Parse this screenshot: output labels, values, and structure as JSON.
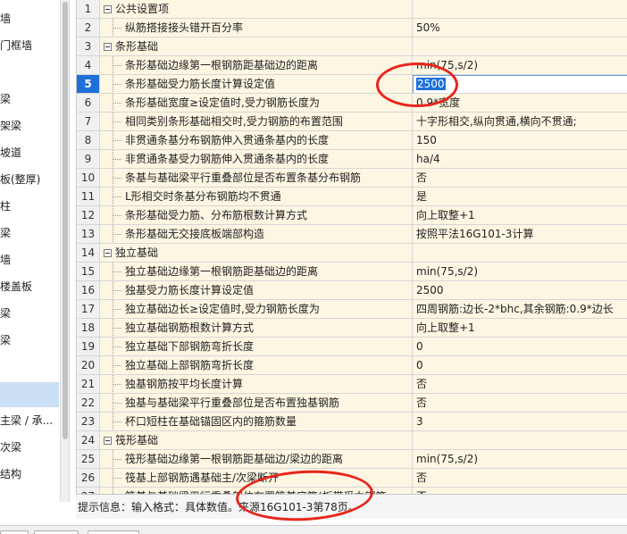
{
  "left_panel": {
    "items": [
      {
        "label": "墙"
      },
      {
        "label": "门框墙"
      },
      {
        "label": "梁"
      },
      {
        "label": "架梁"
      },
      {
        "label": "坡道"
      },
      {
        "label": "板(整厚)"
      },
      {
        "label": "柱"
      },
      {
        "label": "梁"
      },
      {
        "label": "墙"
      },
      {
        "label": "楼盖板"
      },
      {
        "label": "梁"
      },
      {
        "label": "梁"
      },
      {
        "label": ""
      },
      {
        "label": "主梁 / 承..."
      },
      {
        "label": "次梁"
      },
      {
        "label": "结构"
      }
    ]
  },
  "grid": {
    "rows": [
      {
        "num": "1",
        "name": "公共设置项",
        "value": "",
        "group": true
      },
      {
        "num": "2",
        "name": "纵筋搭接接头错开百分率",
        "value": "50%"
      },
      {
        "num": "3",
        "name": "条形基础",
        "value": "",
        "group": true
      },
      {
        "num": "4",
        "name": "条形基础边缘第一根钢筋距基础边的距离",
        "value": "min(75,s/2)"
      },
      {
        "num": "5",
        "name": "条形基础受力筋长度计算设定值",
        "value": "2500",
        "editing": true
      },
      {
        "num": "6",
        "name": "条形基础宽度≥设定值时,受力钢筋长度为",
        "value": "0.9*宽度"
      },
      {
        "num": "7",
        "name": "相同类别条形基础相交时,受力钢筋的布置范围",
        "value": "十字形相交,纵向贯通,横向不贯通;"
      },
      {
        "num": "8",
        "name": "非贯通条基分布钢筋伸入贯通条基内的长度",
        "value": "150"
      },
      {
        "num": "9",
        "name": "非贯通条基受力钢筋伸入贯通条基内的长度",
        "value": "ha/4"
      },
      {
        "num": "10",
        "name": "条基与基础梁平行重叠部位是否布置条基分布钢筋",
        "value": "否"
      },
      {
        "num": "11",
        "name": "L形相交时条基分布钢筋均不贯通",
        "value": "是"
      },
      {
        "num": "12",
        "name": "条形基础受力筋、分布筋根数计算方式",
        "value": "向上取整+1"
      },
      {
        "num": "13",
        "name": "条形基础无交接底板端部构造",
        "value": "按照平法16G101-3计算"
      },
      {
        "num": "14",
        "name": "独立基础",
        "value": "",
        "group": true
      },
      {
        "num": "15",
        "name": "独立基础边缘第一根钢筋距基础边的距离",
        "value": "min(75,s/2)"
      },
      {
        "num": "16",
        "name": "独基受力筋长度计算设定值",
        "value": "2500"
      },
      {
        "num": "17",
        "name": "独立基础边长≥设定值时,受力钢筋长度为",
        "value": "四周钢筋:边长-2*bhc,其余钢筋:0.9*边长"
      },
      {
        "num": "18",
        "name": "独立基础钢筋根数计算方式",
        "value": "向上取整+1"
      },
      {
        "num": "19",
        "name": "独立基础下部钢筋弯折长度",
        "value": "0"
      },
      {
        "num": "20",
        "name": "独立基础上部钢筋弯折长度",
        "value": "0"
      },
      {
        "num": "21",
        "name": "独基钢筋按平均长度计算",
        "value": "否"
      },
      {
        "num": "22",
        "name": "独基与基础梁平行重叠部位是否布置独基钢筋",
        "value": "否"
      },
      {
        "num": "23",
        "name": "杯口短柱在基础锚固区内的箍筋数量",
        "value": "3"
      },
      {
        "num": "24",
        "name": "筏形基础",
        "value": "",
        "group": true
      },
      {
        "num": "25",
        "name": "筏形基础边缘第一根钢筋距基础边/梁边的距离",
        "value": "min(75,s/2)"
      },
      {
        "num": "26",
        "name": "筏基上部钢筋遇基础主/次梁断开",
        "value": "否"
      },
      {
        "num": "27",
        "name": "筏基与基础梁平行重叠部位布置筏基底筋(板带受力钢筋",
        "value": "否"
      }
    ]
  },
  "hint": {
    "text": "提示信息：输入格式：具体数值。来源16G101-3第78页。"
  },
  "colors": {
    "annotation_red": "#e8251b",
    "row_bg": "#fdf6e3",
    "active_row": "#1e6fd9"
  }
}
